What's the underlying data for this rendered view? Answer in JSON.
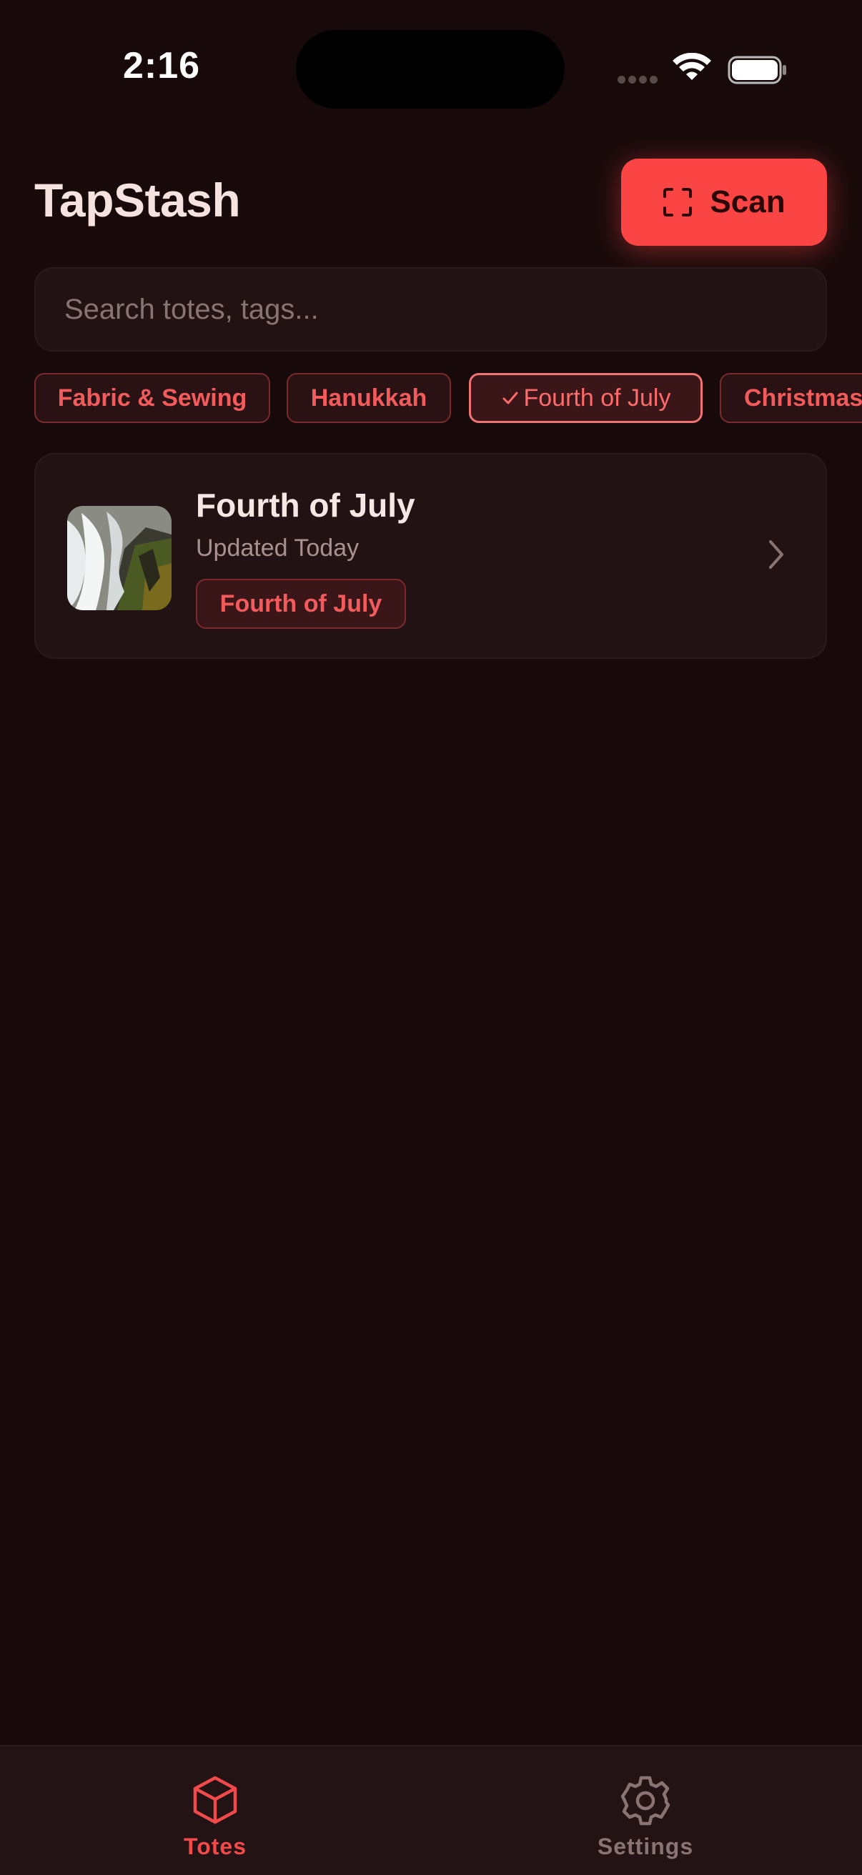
{
  "status_bar": {
    "time": "2:16"
  },
  "header": {
    "title": "TapStash",
    "scan_label": "Scan"
  },
  "search": {
    "placeholder": "Search totes, tags..."
  },
  "filters": [
    {
      "label": "Fabric & Sewing",
      "selected": false
    },
    {
      "label": "Hanukkah",
      "selected": false
    },
    {
      "label": "Fourth of July",
      "selected": true
    },
    {
      "label": "Christmas",
      "selected": false
    }
  ],
  "totes": [
    {
      "title": "Fourth of July",
      "updated": "Updated Today",
      "tag": "Fourth of July"
    }
  ],
  "tab_bar": {
    "tabs": [
      {
        "label": "Totes",
        "icon": "cube-icon",
        "active": true
      },
      {
        "label": "Settings",
        "icon": "gear-icon",
        "active": false
      }
    ]
  },
  "colors": {
    "background": "#180a0b",
    "accent": "#fb4545",
    "surface": "#221214",
    "chip_text": "#f25b5b"
  }
}
